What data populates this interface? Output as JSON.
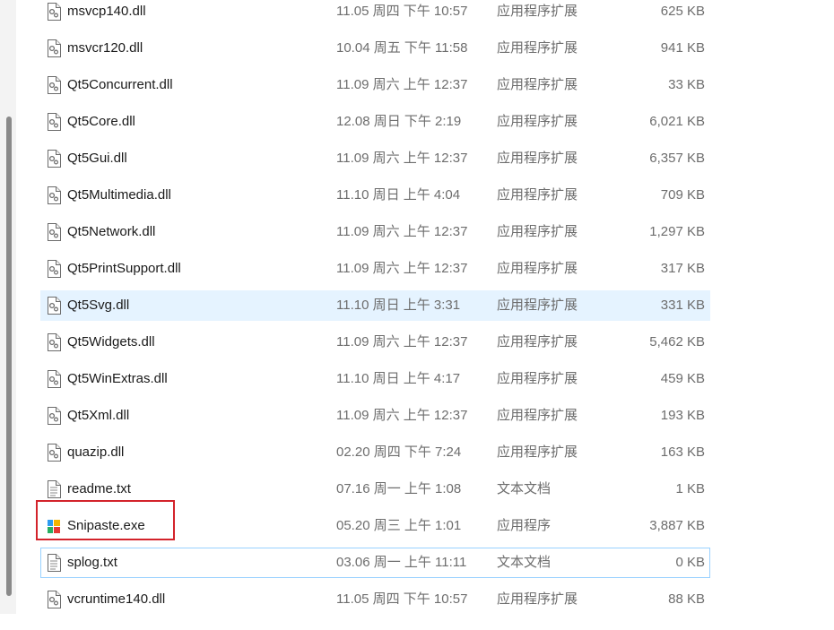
{
  "files": [
    {
      "name": "msvcp140.dll",
      "date": "11.05 周四 下午 10:57",
      "type": "应用程序扩展",
      "size": "625 KB",
      "icon": "dll-file-icon"
    },
    {
      "name": "msvcr120.dll",
      "date": "10.04 周五 下午 11:58",
      "type": "应用程序扩展",
      "size": "941 KB",
      "icon": "dll-file-icon"
    },
    {
      "name": "Qt5Concurrent.dll",
      "date": "11.09 周六 上午 12:37",
      "type": "应用程序扩展",
      "size": "33 KB",
      "icon": "dll-file-icon"
    },
    {
      "name": "Qt5Core.dll",
      "date": "12.08 周日 下午 2:19",
      "type": "应用程序扩展",
      "size": "6,021 KB",
      "icon": "dll-file-icon"
    },
    {
      "name": "Qt5Gui.dll",
      "date": "11.09 周六 上午 12:37",
      "type": "应用程序扩展",
      "size": "6,357 KB",
      "icon": "dll-file-icon"
    },
    {
      "name": "Qt5Multimedia.dll",
      "date": "11.10 周日 上午 4:04",
      "type": "应用程序扩展",
      "size": "709 KB",
      "icon": "dll-file-icon"
    },
    {
      "name": "Qt5Network.dll",
      "date": "11.09 周六 上午 12:37",
      "type": "应用程序扩展",
      "size": "1,297 KB",
      "icon": "dll-file-icon"
    },
    {
      "name": "Qt5PrintSupport.dll",
      "date": "11.09 周六 上午 12:37",
      "type": "应用程序扩展",
      "size": "317 KB",
      "icon": "dll-file-icon"
    },
    {
      "name": "Qt5Svg.dll",
      "date": "11.10 周日 上午 3:31",
      "type": "应用程序扩展",
      "size": "331 KB",
      "icon": "dll-file-icon",
      "state": "selected"
    },
    {
      "name": "Qt5Widgets.dll",
      "date": "11.09 周六 上午 12:37",
      "type": "应用程序扩展",
      "size": "5,462 KB",
      "icon": "dll-file-icon"
    },
    {
      "name": "Qt5WinExtras.dll",
      "date": "11.10 周日 上午 4:17",
      "type": "应用程序扩展",
      "size": "459 KB",
      "icon": "dll-file-icon"
    },
    {
      "name": "Qt5Xml.dll",
      "date": "11.09 周六 上午 12:37",
      "type": "应用程序扩展",
      "size": "193 KB",
      "icon": "dll-file-icon"
    },
    {
      "name": "quazip.dll",
      "date": "02.20 周四 下午 7:24",
      "type": "应用程序扩展",
      "size": "163 KB",
      "icon": "dll-file-icon"
    },
    {
      "name": "readme.txt",
      "date": "07.16 周一 上午 1:08",
      "type": "文本文档",
      "size": "1 KB",
      "icon": "text-file-icon"
    },
    {
      "name": "Snipaste.exe",
      "date": "05.20 周三 上午 1:01",
      "type": "应用程序",
      "size": "3,887 KB",
      "icon": "snipaste-app-icon",
      "state": "annotated"
    },
    {
      "name": "splog.txt",
      "date": "03.06 周一 上午 11:11",
      "type": "文本文档",
      "size": "0 KB",
      "icon": "text-file-icon",
      "state": "focused"
    },
    {
      "name": "vcruntime140.dll",
      "date": "11.05 周四 下午 10:57",
      "type": "应用程序扩展",
      "size": "88 KB",
      "icon": "dll-file-icon"
    }
  ],
  "colors": {
    "selected_row": "#e5f3ff",
    "focus_border": "#99d1ff",
    "annotation_box": "#d3232b",
    "name_text": "#1a1a1a",
    "detail_text": "#6d6d6d"
  }
}
